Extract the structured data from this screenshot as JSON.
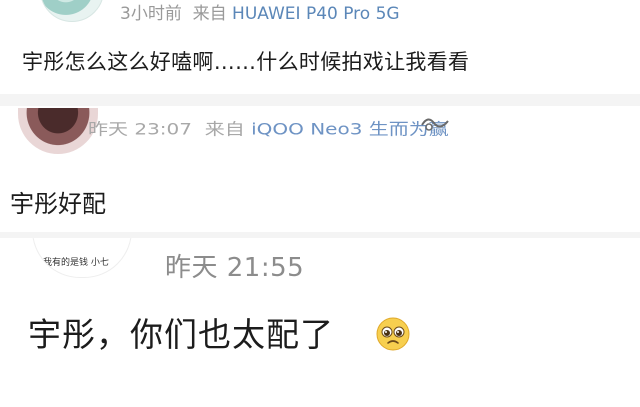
{
  "comments": [
    {
      "time": "3小时前",
      "from_prefix": "来自",
      "device": "HUAWEI P40 Pro 5G",
      "text": "宇彤怎么这么好嗑啊……什么时候拍戏让我看看"
    },
    {
      "time": "昨天 23:07",
      "from_prefix": "来自",
      "device": "iQOO Neo3 生而为赢",
      "text": "宇彤好配"
    },
    {
      "time": "昨天 21:55",
      "avatar_caption": "我有的是钱 小七",
      "text": "宇彤，你们也太配了",
      "emoji": "pleading-face-icon"
    }
  ],
  "colors": {
    "background": "#f4f4f4",
    "card": "#ffffff",
    "meta_text": "#9a9a9a",
    "source_link": "#5b87b8"
  }
}
